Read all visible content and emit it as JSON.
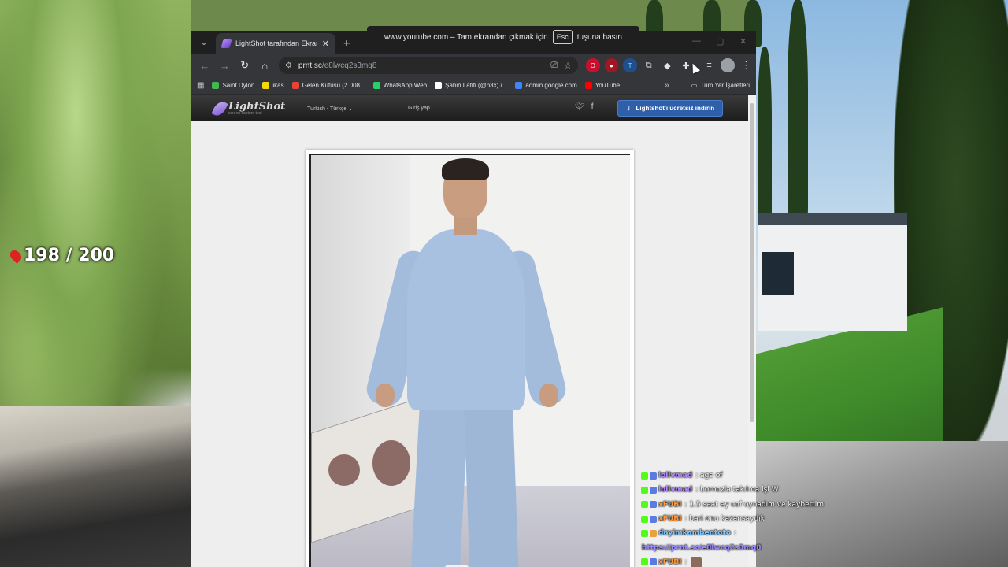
{
  "overlay": {
    "progress_counter": "198 / 200",
    "fullscreen_notice": {
      "prefix": "www.youtube.com – Tam ekrandan çıkmak için",
      "key": "Esc",
      "suffix": "tuşuna basın"
    }
  },
  "browser": {
    "tab": {
      "title": "LightShot tarafından Ekran Görü",
      "close_glyph": "✕"
    },
    "new_tab_glyph": "+",
    "url_host": "prnt.sc",
    "url_path": "/e8lwcq2s3mq8",
    "bookmarks": [
      {
        "label": "Saint Dylon",
        "icon_color": "#3fb950"
      },
      {
        "label": "ikas",
        "icon_color": "#f5d90a"
      },
      {
        "label": "Gelen Kutusu (2.008...",
        "icon_color": "#ea4335"
      },
      {
        "label": "WhatsApp Web",
        "icon_color": "#25d366"
      },
      {
        "label": "Şahin Latifi (@h3x) /...",
        "icon_color": "#ffffff"
      },
      {
        "label": "admin.google.com",
        "icon_color": "#4285f4"
      },
      {
        "label": "YouTube",
        "icon_color": "#ff0000"
      }
    ],
    "bookmarks_more": "»",
    "all_bookmarks": "Tüm Yer İşaretleri"
  },
  "lightshot": {
    "logo_name": "LightShot",
    "logo_tagline": "screen capture tool",
    "language": "Turkish - Türkçe",
    "login": "Giriş yap",
    "download_button": "Lightshot'ı ücretsiz indirin"
  },
  "chat": [
    {
      "user": "lollvmad",
      "user_color": "#b58cff",
      "text": ": age of",
      "badges": [
        "b-kick",
        "b-sub"
      ]
    },
    {
      "user": "lollvmad",
      "user_color": "#b58cff",
      "text": ": bornozla takılma işi W",
      "badges": [
        "b-kick",
        "b-sub"
      ]
    },
    {
      "user": "xFUBI",
      "user_color": "#ff9a3c",
      "text": ": 1.5 saat ey cof oynadım ve kaybettim",
      "badges": [
        "b-kick",
        "b-sub"
      ]
    },
    {
      "user": "xFUBI",
      "user_color": "#ff9a3c",
      "text": ": bari onu kazansaydık",
      "badges": [
        "b-kick",
        "b-sub"
      ]
    },
    {
      "user": "dayimkambentoto",
      "user_color": "#7fc6ff",
      "text": ":",
      "badges": [
        "b-kick",
        "b-gift"
      ]
    },
    {
      "link": "https://prnt.sc/e8lwcq2s3mq8"
    },
    {
      "user": "xFUBI",
      "user_color": "#ff9a3c",
      "text": ":",
      "badges": [
        "b-kick",
        "b-sub"
      ],
      "avatar": true
    }
  ]
}
